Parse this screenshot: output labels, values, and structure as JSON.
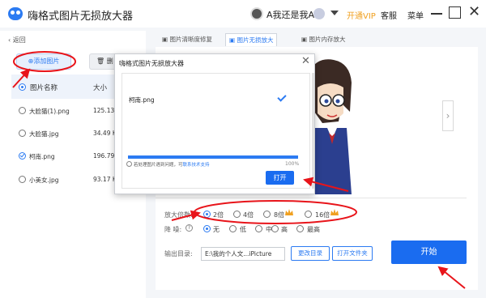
{
  "titlebar": {
    "app_title": "嗨格式图片无损放大器",
    "username": "A我还是我A",
    "vip_link": "开通VIP",
    "service_link": "客服",
    "menu_link": "菜单",
    "close_glyph": "✕"
  },
  "left_panel": {
    "back_label": "返回",
    "add_image_label": "添加图片",
    "delete_label": "删",
    "header_name": "图片名称",
    "header_size": "大小",
    "files": [
      {
        "name": "大脸猫(1).png",
        "size": "125.13",
        "selected": false
      },
      {
        "name": "大脸猫.jpg",
        "size": "34.49 K",
        "selected": false
      },
      {
        "name": "柯南.png",
        "size": "196.79",
        "selected": true
      },
      {
        "name": "小美女.jpg",
        "size": "93.17 K",
        "selected": false
      }
    ]
  },
  "tabs": [
    {
      "label": "图片清晰度修复",
      "active": false
    },
    {
      "label": "图片无损放大",
      "active": true
    },
    {
      "label": "图片内存放大",
      "active": false
    }
  ],
  "main": {
    "next_arrow": "›"
  },
  "settings": {
    "scale_label": "放大倍数:",
    "scale_options": [
      {
        "label": "2倍",
        "checked": true,
        "vip": false
      },
      {
        "label": "4倍",
        "checked": false,
        "vip": false
      },
      {
        "label": "8倍",
        "checked": false,
        "vip": true
      },
      {
        "label": "16倍",
        "checked": false,
        "vip": true
      }
    ],
    "noise_label": "降 噪:",
    "noise_options": [
      {
        "label": "无",
        "checked": true
      },
      {
        "label": "低",
        "checked": false
      },
      {
        "label": "中",
        "checked": false
      },
      {
        "label": "高",
        "checked": false
      },
      {
        "label": "最高",
        "checked": false
      }
    ],
    "output_label": "输出目录:",
    "output_path": "E:\\我的个人文...iPicture",
    "change_dir_label": "更改目录",
    "open_folder_label": "打开文件夹",
    "start_label": "开始"
  },
  "dialog": {
    "title": "嗨格式图片无损放大器",
    "close_glyph": "✕",
    "file_name": "柯南.png",
    "progress": 100,
    "progress_text": "100%",
    "help_text": "若处理图片遇到问题，可",
    "help_link": "联系技术支持",
    "open_label": "打开"
  },
  "colors": {
    "accent": "#2c7bf2",
    "annotation": "#e8141a",
    "vip": "#f0a020"
  }
}
